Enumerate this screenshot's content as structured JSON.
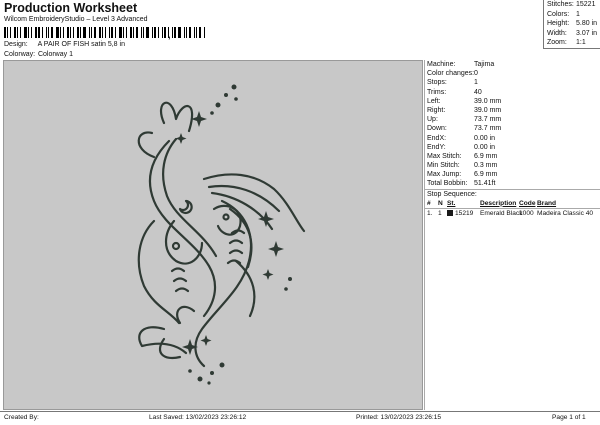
{
  "header": {
    "title": "Production Worksheet",
    "subtitle": "Wilcom EmbroideryStudio – Level 3 Advanced",
    "barcode_mark": ","
  },
  "design_info": {
    "design_label": "Design:",
    "design_value": "A PAIR OF FISH satin 5,8 in",
    "colorway_label": "Colorway:",
    "colorway_value": "Colorway 1"
  },
  "stats": [
    {
      "label": "Stitches:",
      "value": "15221"
    },
    {
      "label": "Colors:",
      "value": "1"
    },
    {
      "label": "Height:",
      "value": "5.80 in"
    },
    {
      "label": "Width:",
      "value": "3.07 in"
    },
    {
      "label": "Zoom:",
      "value": "1:1"
    }
  ],
  "machine_info": [
    {
      "label": "Machine:",
      "value": "Tajima"
    },
    {
      "label": "Color changes:",
      "value": "0"
    },
    {
      "label": "Stops:",
      "value": "1"
    },
    {
      "label": "Trims:",
      "value": "40"
    },
    {
      "label": "Left:",
      "value": "39.0 mm"
    },
    {
      "label": "Right:",
      "value": "39.0 mm"
    },
    {
      "label": "Up:",
      "value": "73.7 mm"
    },
    {
      "label": "Down:",
      "value": "73.7 mm"
    },
    {
      "label": "EndX:",
      "value": "0.00 in"
    },
    {
      "label": "EndY:",
      "value": "0.00 in"
    },
    {
      "label": "Max Stitch:",
      "value": "6.9 mm"
    },
    {
      "label": "Min Stitch:",
      "value": "0.3 mm"
    },
    {
      "label": "Max Jump:",
      "value": "6.9 mm"
    },
    {
      "label": "Total Bobbin:",
      "value": "51.41ft"
    }
  ],
  "stop_sequence": {
    "title": "Stop Sequence:",
    "headers": {
      "num": "#",
      "n": "N",
      "st": "St.",
      "desc": "Description",
      "code": "Code",
      "brand": "Brand"
    },
    "rows": [
      {
        "num": "1.",
        "n": "1",
        "swatch": "#1a1a1a",
        "st": "15219",
        "desc": "Emerald Black",
        "code": "1000",
        "brand": "Madeira Classic 40"
      }
    ]
  },
  "footer": {
    "created_by": "Created By:",
    "last_saved": "Last Saved: 13/02/2023 23:26:12",
    "printed": "Printed: 13/02/2023 23:26:15",
    "page": "Page 1 of 1"
  },
  "colors": {
    "canvas_bg": "#c8c8c8",
    "thread": "#2f3a34"
  }
}
